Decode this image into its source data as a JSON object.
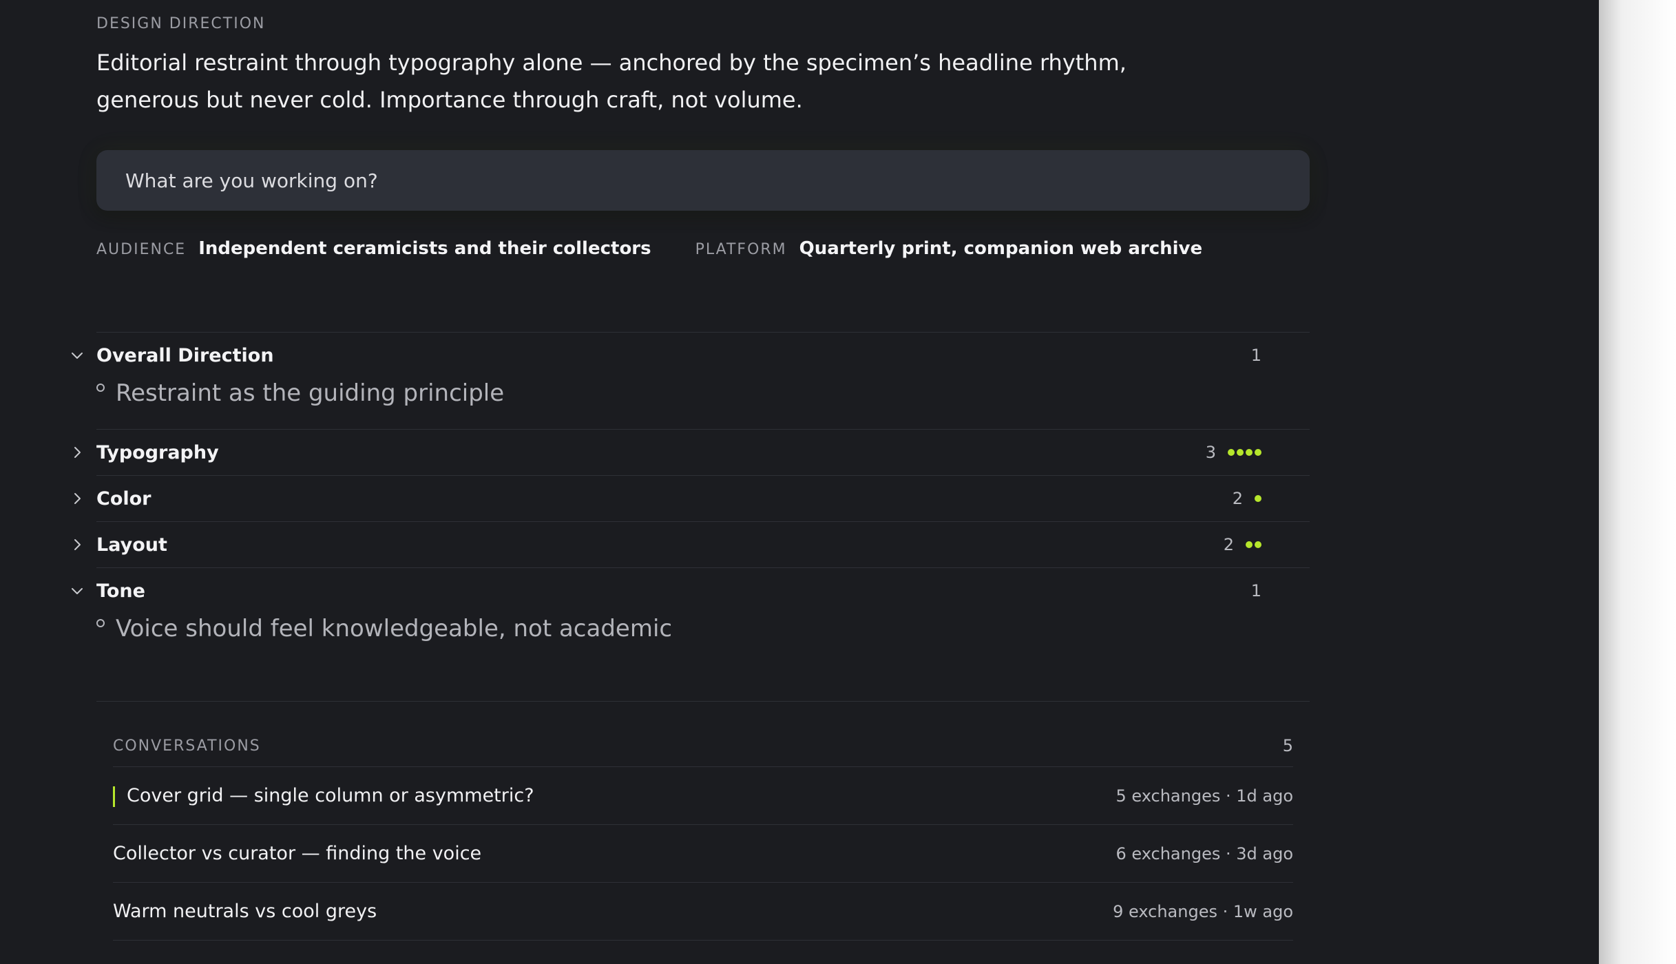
{
  "header": {
    "eyebrow": "DESIGN DIRECTION",
    "direction": "Editorial restraint through typography alone — anchored by the specimen’s headline rhythm, generous but never cold. Importance through craft, not volume."
  },
  "prompt": {
    "placeholder": "What are you working on?"
  },
  "meta": {
    "audience_label": "AUDIENCE",
    "audience_value": "Independent ceramicists and their collectors",
    "platform_label": "PLATFORM",
    "platform_value": "Quarterly print, companion web archive"
  },
  "sections": [
    {
      "title": "Overall Direction",
      "count": "1",
      "expanded": true,
      "dots": 0,
      "items": [
        "Restraint as the guiding principle"
      ]
    },
    {
      "title": "Typography",
      "count": "3",
      "expanded": false,
      "dots": 4,
      "items": []
    },
    {
      "title": "Color",
      "count": "2",
      "expanded": false,
      "dots": 1,
      "items": []
    },
    {
      "title": "Layout",
      "count": "2",
      "expanded": false,
      "dots": 2,
      "items": []
    },
    {
      "title": "Tone",
      "count": "1",
      "expanded": true,
      "dots": 0,
      "items": [
        "Voice should feel knowledgeable, not academic"
      ]
    }
  ],
  "conversations": {
    "label": "CONVERSATIONS",
    "count": "5",
    "items": [
      {
        "title": "Cover grid — single column or asymmetric?",
        "meta": "5 exchanges · 1d ago",
        "active": true
      },
      {
        "title": "Collector vs curator — finding the voice",
        "meta": "6 exchanges · 3d ago",
        "active": false
      },
      {
        "title": "Warm neutrals vs cool greys",
        "meta": "9 exchanges · 1w ago",
        "active": false
      }
    ]
  },
  "colors": {
    "background": "#1b1c20",
    "input_background": "#2d3038",
    "accent": "#b6e62c"
  }
}
